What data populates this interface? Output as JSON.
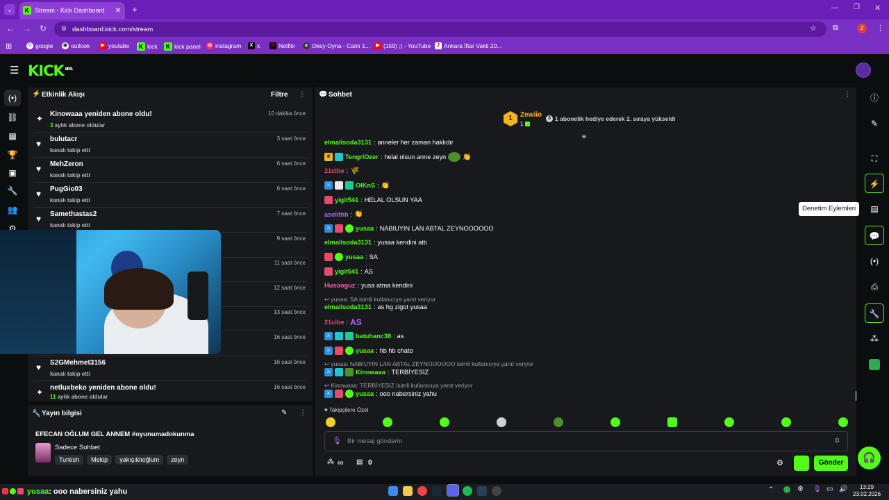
{
  "browser": {
    "tab_title": "Stream - Kick Dashboard",
    "url": "dashboard.kick.com/stream",
    "profile_initial": "Z",
    "bookmarks": [
      "google",
      "outlook",
      "youtube",
      "kick",
      "kick panel",
      "instagram",
      "x",
      "Netflix",
      "Okey Oyna - Canlı 1...",
      "(159) ;) - YouTube",
      "Ankara İftar Vakti 20..."
    ]
  },
  "kick": {
    "logo": "KICK",
    "logo_sup": "BETA"
  },
  "activity": {
    "title": "Etkinlik Akışı",
    "filter_label": "Filtre",
    "items": [
      {
        "name": "Kinowaaa yeniden abone oldu!",
        "sub_num": "3",
        "sub": " aylık abone oldular",
        "time": "10 dakika önce"
      },
      {
        "name": "bulutacr",
        "sub": "kanalı takip etti",
        "time": "3 saat önce"
      },
      {
        "name": "MehZeron",
        "sub": "kanalı takip etti",
        "time": "6 saat önce"
      },
      {
        "name": "PugGio03",
        "sub": "kanalı takip etti",
        "time": "6 saat önce"
      },
      {
        "name": "Samethastas2",
        "sub": "kanalı takip etti",
        "time": "7 saat önce"
      },
      {
        "name": "",
        "sub": "",
        "time": "9 saat önce"
      },
      {
        "name": "",
        "sub": "",
        "time": "11 saat önce"
      },
      {
        "name": "",
        "sub": "",
        "time": "12 saat önce"
      },
      {
        "name": "",
        "sub": "",
        "time": "13 saat önce"
      },
      {
        "name": "",
        "sub": "",
        "time": "16 saat önce"
      },
      {
        "name": "S2GMehmet3156",
        "sub": "kanalı takip etti",
        "time": "16 saat önce"
      },
      {
        "name": "netluxbeko yeniden abone oldu!",
        "sub_num": "11",
        "sub": " aylık abone oldular",
        "time": "16 saat önce"
      }
    ]
  },
  "stream_info": {
    "title": "Yayın bilgisi",
    "stream_title": "EFECAN OĞLUM GEL ANNEM #oyunumadokunma",
    "category": "Sadece Sohbet",
    "tags": [
      "Turkish",
      "Mekip",
      "yakışıklıoğlum",
      "zeyn"
    ]
  },
  "chat": {
    "title": "Sohbet",
    "pinned_user": "Zewiio",
    "pinned_rank": "1",
    "pinned_count": "1",
    "pinned_gift_num": "3",
    "pinned_text": "1 abonelik hediye ederek 2. sıraya yükseldi",
    "tooltip": "Denetim Eylemleri",
    "messages": [
      {
        "user": "elmalisoda3131",
        "text": "anneler her zaman haklıdır",
        "color": "#53fc18"
      },
      {
        "user": "TengriOzer",
        "text": "helal olsun anne zeyn",
        "color": "#53fc18"
      },
      {
        "user": "21cibe",
        "text": "",
        "color": "#e64b6b"
      },
      {
        "user": "OlKnS",
        "text": "",
        "color": "#53fc18"
      },
      {
        "user": "yigit541",
        "text": "HELAL OLSUN YAA",
        "color": "#53fc18"
      },
      {
        "user": "aselithh",
        "text": "",
        "color": "#b069ff"
      },
      {
        "user": "yusaa",
        "text": "NABIUYIN LAN ABTAL ZEYNOOOOOO",
        "color": "#53fc18"
      },
      {
        "user": "elmalisoda3131",
        "text": "yusaa kendini attı",
        "color": "#53fc18"
      },
      {
        "user": "yusaa",
        "text": "SA",
        "color": "#53fc18"
      },
      {
        "user": "yigit541",
        "text": "AS",
        "color": "#53fc18"
      },
      {
        "user": "Husooguz",
        "text": "yusa atma kendini",
        "color": "#ff5fa8"
      },
      {
        "reply": "yusaa: SA isimli kullanıcıya yanıt veriyor"
      },
      {
        "user": "elmalisoda3131",
        "text": "as hg zigot yusaa",
        "color": "#53fc18"
      },
      {
        "user": "21cibe",
        "text": "AS",
        "color": "#e64b6b"
      },
      {
        "user": "batuhanc38",
        "text": "as",
        "color": "#53fc18"
      },
      {
        "user": "yusaa",
        "text": "hb hb chato",
        "color": "#53fc18"
      },
      {
        "reply": "yusaa: NABIUYIN LAN ABTAL ZEYNOOOOOO isimli kullanıcıya yanıt veriyor"
      },
      {
        "user": "Kinowaaa",
        "text": "TERBİYESİZ",
        "color": "#53fc18"
      },
      {
        "reply": "Kinowaaa: TERBİYESİZ isimli kullanıcıya yanıt veriyor"
      },
      {
        "user": "yusaa",
        "text": "ooo nabersiniz yahu",
        "color": "#53fc18"
      }
    ],
    "emote_label": "Takipçilere Özel",
    "input_placeholder": "Bir mesaj gönderin",
    "points_label": "∞",
    "bag_count": "0",
    "send_label": "Gönder"
  },
  "taskbar": {
    "notif_user": "yusaa",
    "notif_text": ": ooo nabersiniz yahu",
    "time": "13:29",
    "date": "23.02.2026"
  },
  "colors": {
    "accent": "#53fc18",
    "browser": "#7a2fc4"
  }
}
